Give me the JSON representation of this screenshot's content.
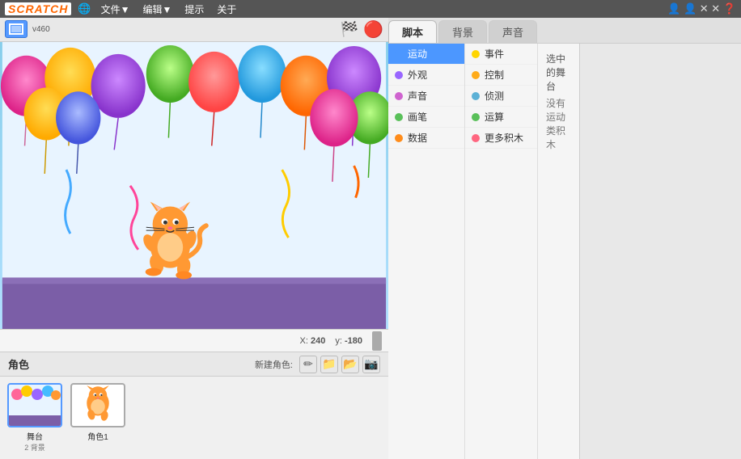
{
  "menubar": {
    "logo": "SCRATCH",
    "items": [
      "🌐",
      "文件▼",
      "编辑▼",
      "提示",
      "关于"
    ],
    "right_icons": [
      "👤",
      "👤",
      "✕✕",
      "✕✕",
      "❓"
    ]
  },
  "stage_toolbar": {
    "label": "v460",
    "flag_label": "🏁",
    "stop_label": "⬤"
  },
  "stage_info": {
    "x_label": "X:",
    "x_value": "240",
    "y_label": "y:",
    "y_value": "-180"
  },
  "tabs": [
    {
      "label": "脚本",
      "active": true
    },
    {
      "label": "背景",
      "active": false
    },
    {
      "label": "声音",
      "active": false
    }
  ],
  "categories_left": [
    {
      "label": "运动",
      "color": "#4C97FF",
      "active": true
    },
    {
      "label": "外观",
      "color": "#9966FF"
    },
    {
      "label": "声音",
      "color": "#CF63CF"
    },
    {
      "label": "画笔",
      "color": "#59C059"
    },
    {
      "label": "数据",
      "color": "#FF8C1A"
    }
  ],
  "categories_right": [
    {
      "label": "事件",
      "color": "#FFD500"
    },
    {
      "label": "控制",
      "color": "#FFAB19"
    },
    {
      "label": "侦测",
      "color": "#5CB1D6"
    },
    {
      "label": "运算",
      "color": "#59C059"
    },
    {
      "label": "更多积木",
      "color": "#FF6680"
    }
  ],
  "info": {
    "title": "选中的舞台",
    "desc": "没有运动类积木"
  },
  "sprite_header": {
    "label": "角色",
    "new_label": "新建角色:",
    "btn_draw": "✏",
    "btn_edit": "✏",
    "btn_surprise": "📁",
    "btn_camera": "📷"
  },
  "sprites": [
    {
      "name": "舞台",
      "sub": "2 背景",
      "selected": true
    },
    {
      "name": "角色1",
      "sub": "",
      "selected": false
    }
  ]
}
